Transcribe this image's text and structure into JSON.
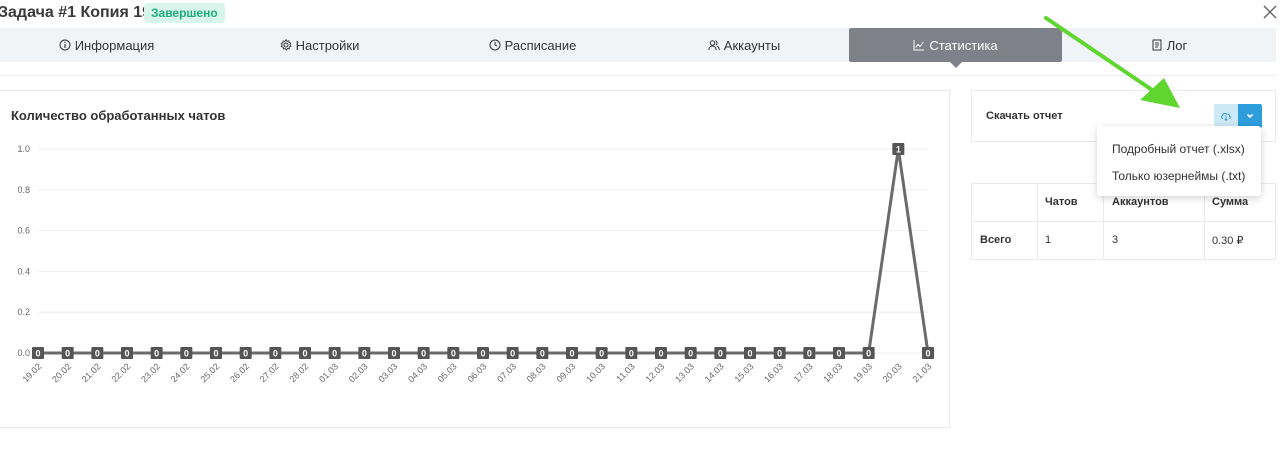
{
  "header": {
    "title": "Задача #1 Копия 19",
    "status_badge": "Завершено",
    "close_icon": "close-icon"
  },
  "tabs": [
    {
      "label": "Информация",
      "icon": "info-icon"
    },
    {
      "label": "Настройки",
      "icon": "gear-icon"
    },
    {
      "label": "Расписание",
      "icon": "clock-icon"
    },
    {
      "label": "Аккаунты",
      "icon": "users-icon"
    },
    {
      "label": "Статистика",
      "icon": "chart-icon",
      "active": true
    },
    {
      "label": "Лог",
      "icon": "document-icon"
    }
  ],
  "colors": {
    "accent": "#2d9ddc",
    "active_tab": "#7e8189",
    "badge_bg": "#d7f5ea",
    "badge_text": "#1eae7e",
    "series": "#6b6b6b",
    "annotation_arrow": "#5fd62f"
  },
  "chart_data": {
    "type": "line",
    "title": "Количество обработанных чатов",
    "xlabel": "",
    "ylabel": "",
    "ylim": [
      0,
      1
    ],
    "yticks": [
      "0.0",
      "0.2",
      "0.4",
      "0.6",
      "0.8",
      "1.0"
    ],
    "grid": true,
    "categories": [
      "19.02",
      "20.02",
      "21.02",
      "22.02",
      "23.02",
      "24.02",
      "25.02",
      "26.02",
      "27.02",
      "28.02",
      "01.03",
      "02.03",
      "03.03",
      "04.03",
      "05.03",
      "06.03",
      "07.03",
      "08.03",
      "09.03",
      "10.03",
      "11.03",
      "12.03",
      "13.03",
      "14.03",
      "15.03",
      "16.03",
      "17.03",
      "18.03",
      "19.03",
      "20.03",
      "21.03"
    ],
    "series": [
      {
        "values": [
          0,
          0,
          0,
          0,
          0,
          0,
          0,
          0,
          0,
          0,
          0,
          0,
          0,
          0,
          0,
          0,
          0,
          0,
          0,
          0,
          0,
          0,
          0,
          0,
          0,
          0,
          0,
          0,
          0,
          1,
          0
        ]
      }
    ]
  },
  "download": {
    "label": "Скачать отчет",
    "button_icon": "cloud-download-icon",
    "dropdown_icon": "chevron-down-icon",
    "menu": [
      "Подробный отчет (.xlsx)",
      "Только юзернеймы (.txt)"
    ]
  },
  "stats_table": {
    "headers": [
      "",
      "Чатов",
      "Аккаунтов",
      "Сумма"
    ],
    "rows": [
      [
        "Всего",
        "1",
        "3",
        "0.30 ₽"
      ]
    ]
  }
}
